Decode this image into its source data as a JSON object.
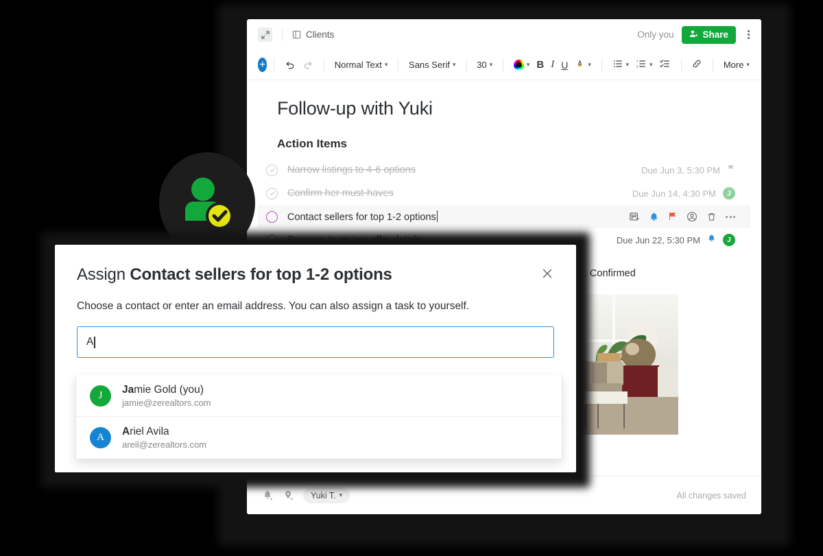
{
  "doc_window": {
    "header": {
      "expand_icon": "expand-icon",
      "breadcrumb_icon": "document-icon",
      "breadcrumb": "Clients",
      "only_you": "Only you",
      "share_label": "Share",
      "share_icon": "person-add-icon",
      "more_icon": "kebab-menu-icon",
      "share_color": "#12a83c"
    },
    "toolbar": {
      "add_label": "+",
      "undo_icon": "undo-icon",
      "redo_icon": "redo-icon",
      "style": "Normal Text",
      "font": "Sans Serif",
      "size": "30",
      "color_icon": "text-color-wheel-icon",
      "bold": "B",
      "italic": "I",
      "underline": "U",
      "highlight_icon": "highlight-pen-icon",
      "bullet_icon": "bulleted-list-icon",
      "numbered_icon": "numbered-list-icon",
      "checklist_icon": "checklist-icon",
      "link_icon": "link-icon",
      "more": "More"
    },
    "body": {
      "title": "Follow-up with Yuki",
      "section_heading": "Action Items",
      "tasks": [
        {
          "text": "Narrow listings to 4-6 options",
          "done": true,
          "due": "Due Jun 3, 5:30 PM",
          "trailing": "flag-icon",
          "assignee": null
        },
        {
          "text": "Confirm her must-haves",
          "done": true,
          "due": "Due Jun 14, 4:30 PM",
          "trailing": "avatar",
          "assignee": "J"
        },
        {
          "text": "Contact sellers for top 1-2 options",
          "done": false,
          "active": true,
          "due": "",
          "icons": [
            "calendar-add-icon",
            "bell-icon",
            "flag-icon",
            "assign-person-icon",
            "trash-icon",
            "overflow-icon"
          ]
        },
        {
          "text": "Regroup to review offer details",
          "done": false,
          "due": "Due Jun 22, 5:30 PM",
          "trailing": "bell-icon",
          "assignee": "J"
        }
      ],
      "paragraph": "in on the second floor. Confirmed",
      "photo_alt": "living-room-photo"
    },
    "footer": {
      "reminder_icon": "add-reminder-icon",
      "location_icon": "add-location-icon",
      "person_chip": "Yuki T.",
      "status": "All changes saved"
    }
  },
  "badge": {
    "icon": "assigned-person-check-icon",
    "circle_color": "#1d1d1d",
    "person_color": "#12a83c",
    "check_color": "#e5e312"
  },
  "modal": {
    "title_prefix": "Assign ",
    "title_task": "Contact sellers for top 1-2 options",
    "close_icon": "close-icon",
    "subtitle": "Choose a contact or enter an email address. You can also assign a task to yourself.",
    "input_value": "A",
    "input_placeholder": "",
    "suggestions": [
      {
        "initial": "J",
        "avatar_color": "#14a83a",
        "match": "Ja",
        "rest": "mie Gold (you)",
        "email": "jamie@zerealtors.com"
      },
      {
        "initial": "A",
        "avatar_color": "#1585d1",
        "match": "A",
        "rest": "riel Avila",
        "email": "areil@zerealtors.com"
      }
    ]
  }
}
